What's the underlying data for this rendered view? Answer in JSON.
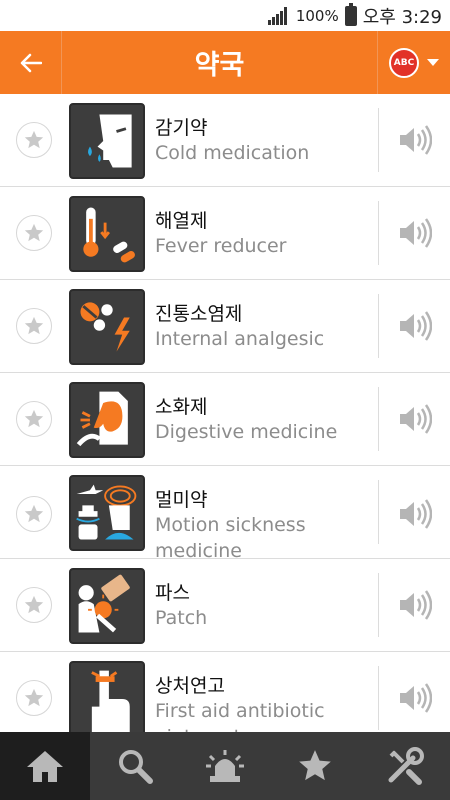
{
  "status_bar": {
    "battery": "100%",
    "time": "오후 3:29"
  },
  "header": {
    "title": "약국",
    "lang_badge": "ABC"
  },
  "items": [
    {
      "ko": "감기약",
      "en": "Cold medication",
      "icon": "cold-medication-icon"
    },
    {
      "ko": "해열제",
      "en": "Fever reducer",
      "icon": "fever-reducer-icon"
    },
    {
      "ko": "진통소염제",
      "en": "Internal analgesic",
      "icon": "analgesic-icon"
    },
    {
      "ko": "소화제",
      "en": "Digestive medicine",
      "icon": "digestive-icon"
    },
    {
      "ko": "멀미약",
      "en": "Motion sickness medicine",
      "icon": "motion-sickness-icon"
    },
    {
      "ko": "파스",
      "en": "Patch",
      "icon": "patch-icon"
    },
    {
      "ko": "상처연고",
      "en": "First aid antibiotic ointment",
      "icon": "ointment-icon"
    }
  ],
  "bottom_nav": [
    "home-icon",
    "search-icon",
    "emergency-siren-icon",
    "favorites-star-icon",
    "settings-tools-icon"
  ],
  "colors": {
    "accent": "#f57a22",
    "thumb_bg": "#3d3d3d",
    "nav_bg": "#3a3a3a"
  }
}
